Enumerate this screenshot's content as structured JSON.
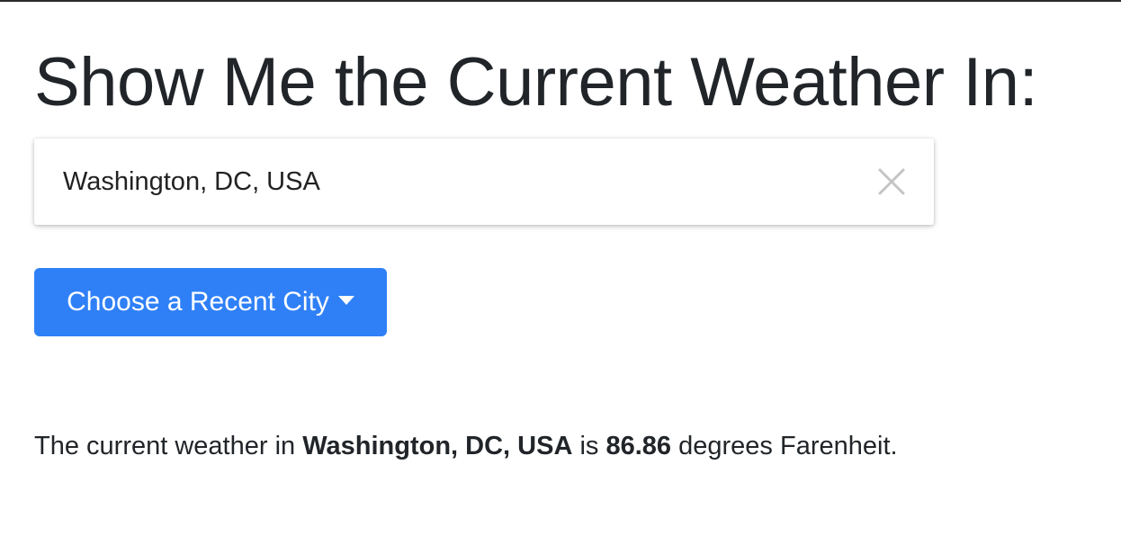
{
  "heading": "Show Me the Current Weather In:",
  "search": {
    "value": "Washington, DC, USA",
    "clear_icon": "close-icon"
  },
  "recent_dropdown": {
    "label": "Choose a Recent City",
    "caret_icon": "caret-down-icon",
    "color": "#2f80f7"
  },
  "result": {
    "prefix": "The current weather in",
    "city": "Washington, DC, USA",
    "middle": "is",
    "temperature": "86.86",
    "suffix": "degrees Farenheit."
  }
}
